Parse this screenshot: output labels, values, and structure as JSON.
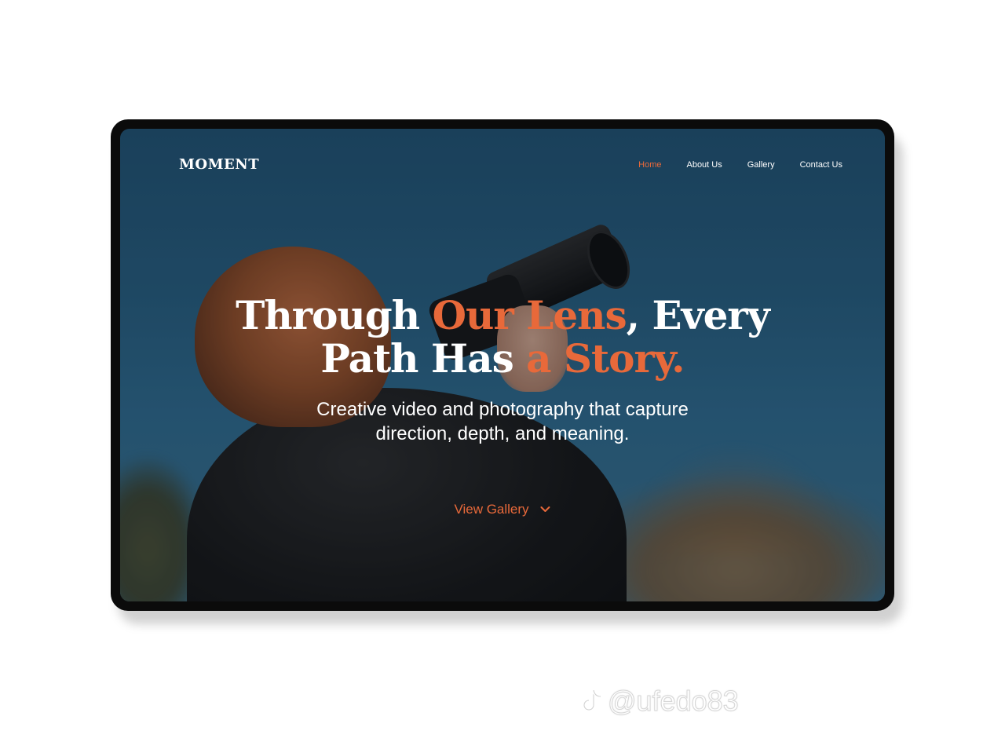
{
  "brand": {
    "logo": "MOMENT"
  },
  "nav": {
    "items": [
      {
        "label": "Home",
        "active": true
      },
      {
        "label": "About Us",
        "active": false
      },
      {
        "label": "Gallery",
        "active": false
      },
      {
        "label": "Contact Us",
        "active": false
      }
    ]
  },
  "hero": {
    "headline_part1": "Through ",
    "headline_accent1": "Our Lens",
    "headline_part2": ", Every",
    "headline_part3": "Path Has ",
    "headline_accent2": "a Story.",
    "subtitle_line1": "Creative video and photography that capture",
    "subtitle_line2": "direction, depth, and meaning.",
    "cta_label": "View Gallery"
  },
  "watermark": {
    "handle": "@ufedo83",
    "icon": "tiktok-icon"
  },
  "colors": {
    "accent": "#e8693a",
    "text": "#ffffff",
    "frame": "#0b0b0b"
  }
}
